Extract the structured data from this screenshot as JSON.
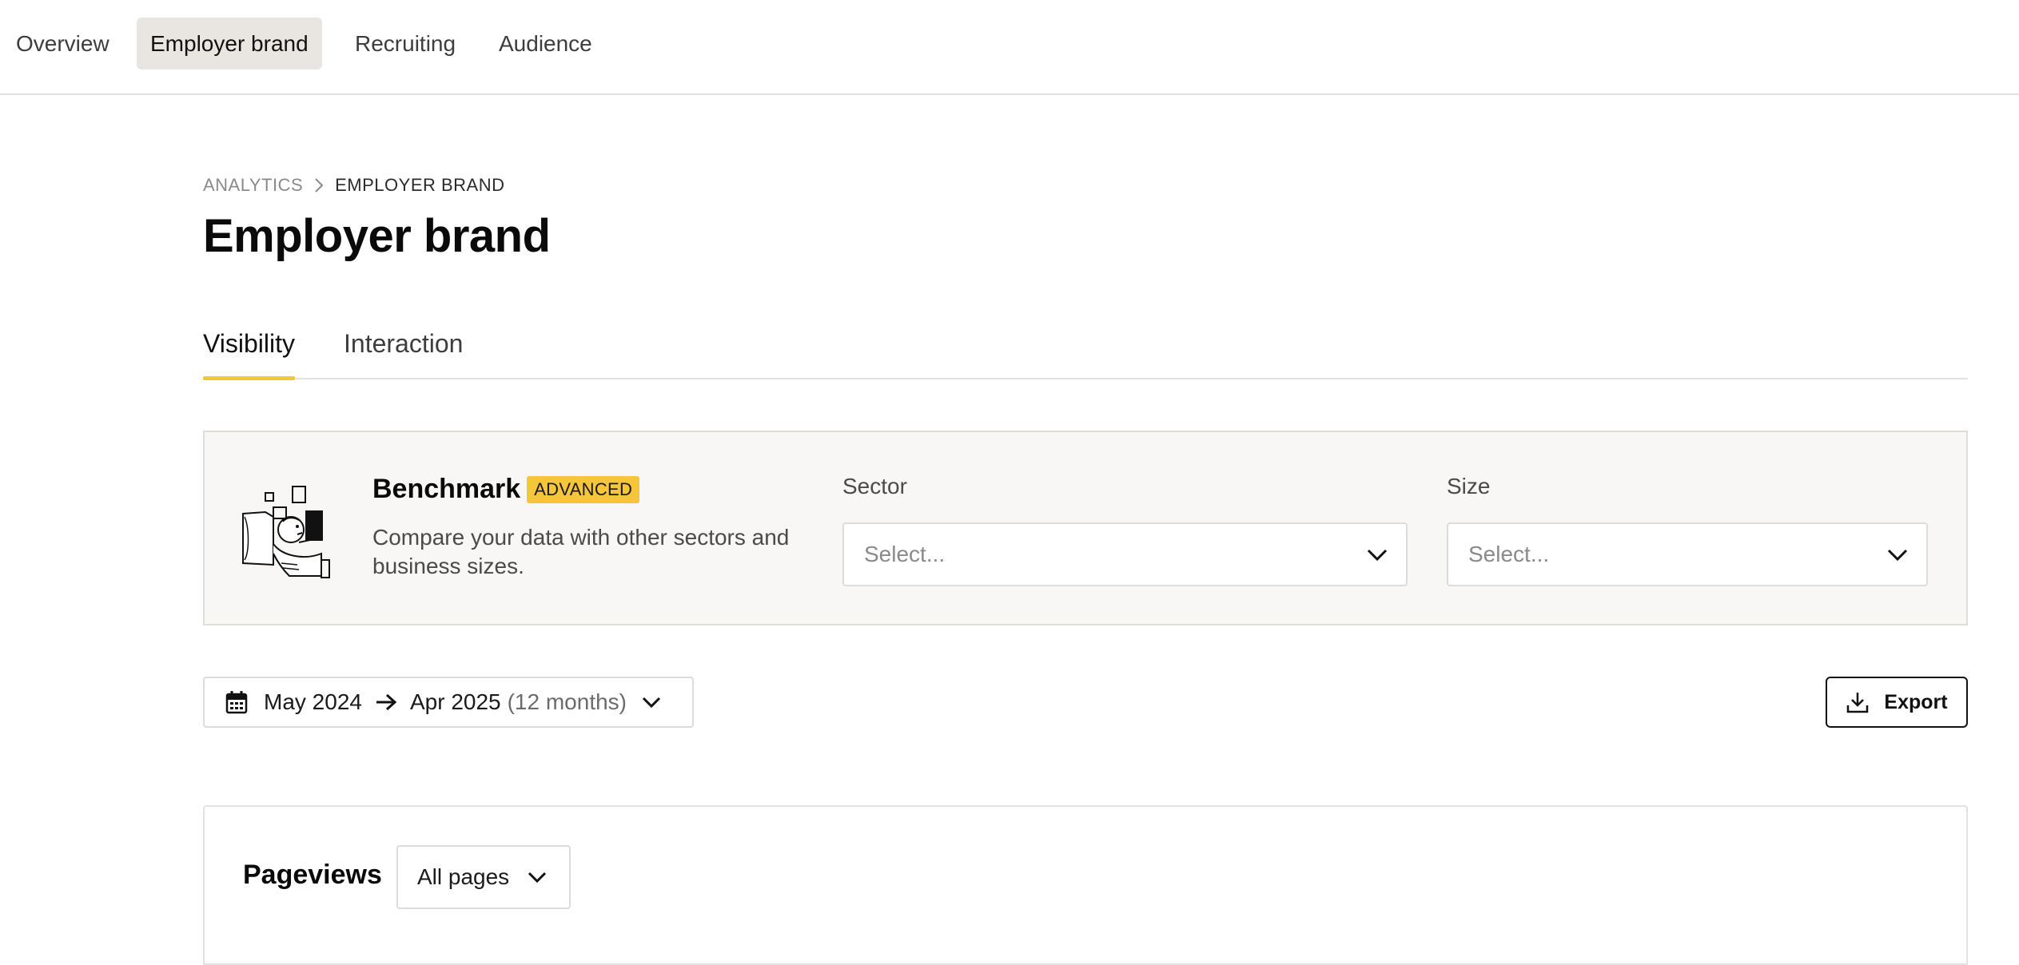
{
  "topnav": {
    "items": [
      {
        "label": "Overview",
        "active": false
      },
      {
        "label": "Employer brand",
        "active": true
      },
      {
        "label": "Recruiting",
        "active": false
      },
      {
        "label": "Audience",
        "active": false
      }
    ]
  },
  "breadcrumb": {
    "root": "ANALYTICS",
    "current": "EMPLOYER BRAND"
  },
  "page": {
    "title": "Employer brand"
  },
  "tabs": [
    {
      "label": "Visibility",
      "active": true
    },
    {
      "label": "Interaction",
      "active": false
    }
  ],
  "benchmark": {
    "title": "Benchmark",
    "badge": "ADVANCED",
    "description": "Compare your data with other sectors and business sizes.",
    "sector": {
      "label": "Sector",
      "placeholder": "Select..."
    },
    "size": {
      "label": "Size",
      "placeholder": "Select..."
    }
  },
  "daterange": {
    "from": "May 2024",
    "to": "Apr 2025",
    "range": "(12 months)"
  },
  "export": {
    "label": "Export"
  },
  "pageviews": {
    "title": "Pageviews",
    "filter_value": "All pages"
  },
  "colors": {
    "accent": "#f5c53a",
    "active_nav_bg": "#e9e5e1",
    "panel_bg": "#f8f7f5"
  }
}
